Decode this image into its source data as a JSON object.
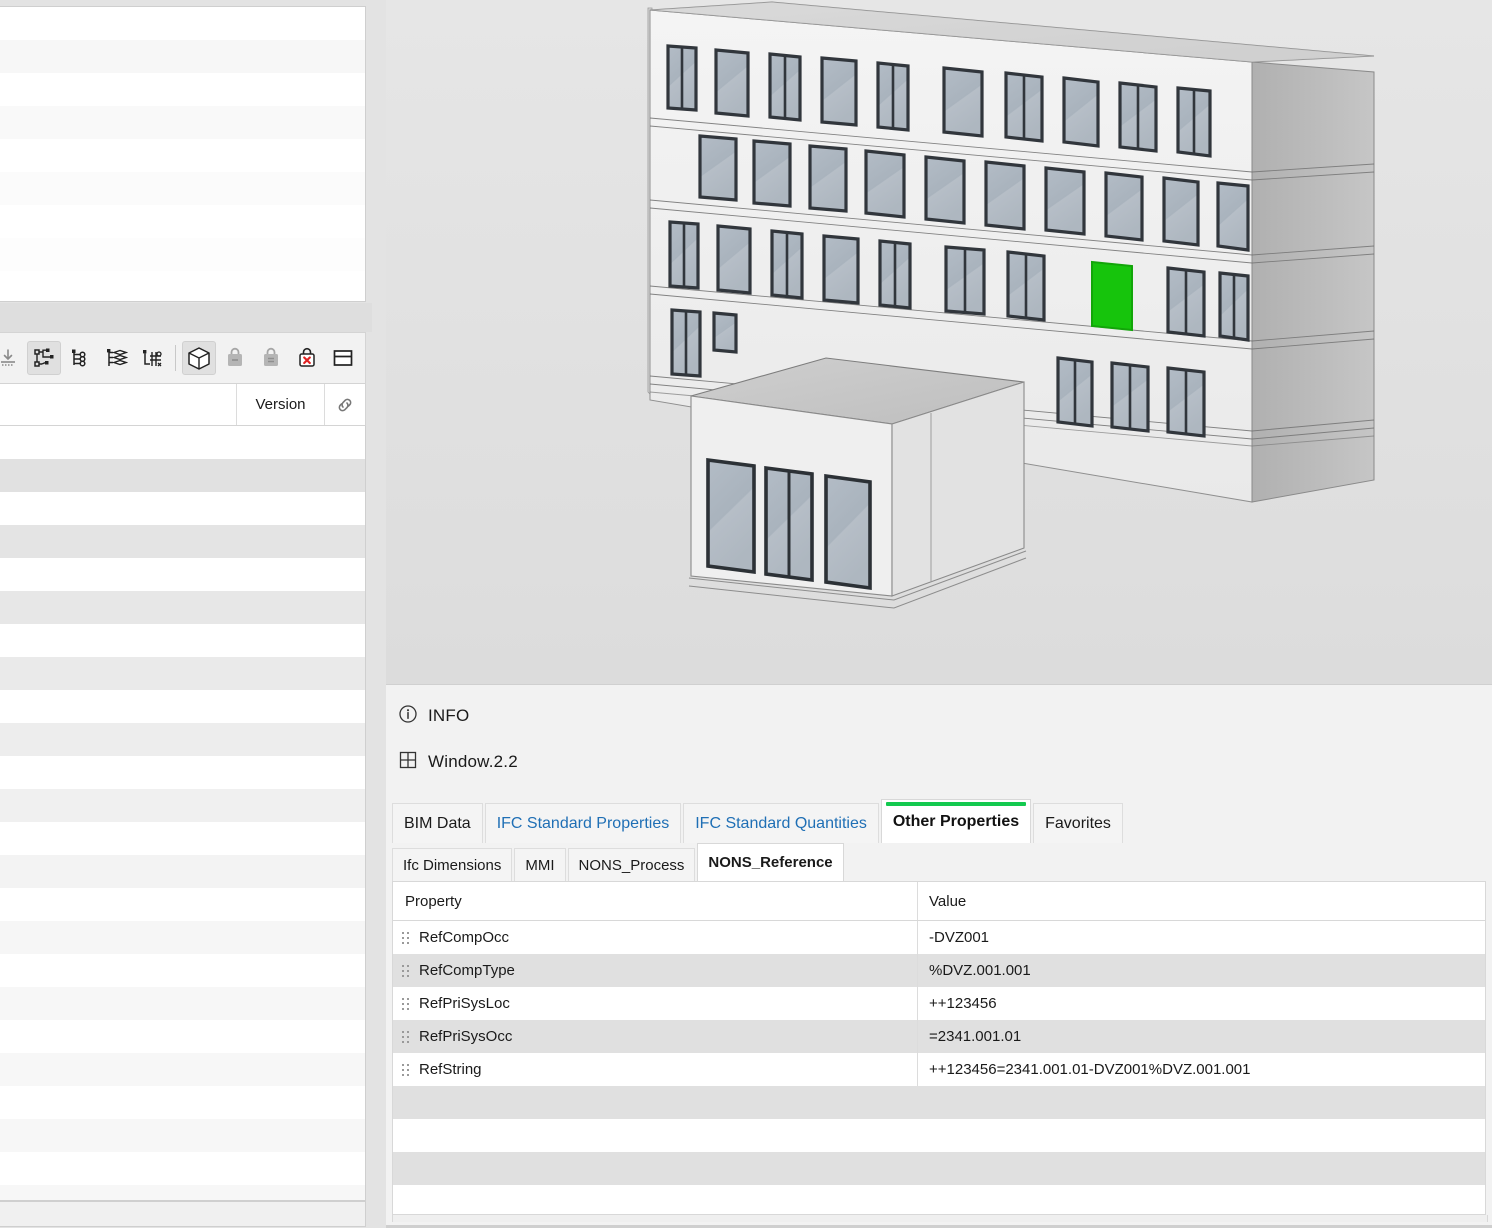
{
  "left_panel": {
    "toolbar": {
      "items": [
        {
          "name": "import-icon",
          "tooltip": "Import",
          "state": "disabled"
        },
        {
          "name": "model-tree-icon",
          "tooltip": "Model Tree",
          "state": "active"
        },
        {
          "name": "list-tree-icon",
          "tooltip": "List Tree",
          "state": "normal"
        },
        {
          "name": "layers-icon",
          "tooltip": "Layers",
          "state": "normal"
        },
        {
          "name": "structure-tree-icon",
          "tooltip": "Structure Tree",
          "state": "normal"
        },
        {
          "name": "cube-3d-icon",
          "tooltip": "3D View",
          "state": "active"
        },
        {
          "name": "bag-gray-icon",
          "tooltip": "Container",
          "state": "disabled"
        },
        {
          "name": "bag-lines-icon",
          "tooltip": "Container List",
          "state": "disabled"
        },
        {
          "name": "bag-delete-icon",
          "tooltip": "Delete Container",
          "state": "normal"
        },
        {
          "name": "panel-layout-icon",
          "tooltip": "Panel Layout",
          "state": "normal"
        }
      ]
    },
    "columns": {
      "version_label": "Version",
      "link_icon": "link-icon"
    },
    "upper_row_count": 9,
    "lower_row_count": 24
  },
  "viewport": {
    "name": "3d-model-viewport",
    "highlight_color": "#16c40c",
    "building": {
      "facade_color": "#f0f0f0",
      "side_color": "#b9b9b9",
      "roof_color": "#c9c9c9",
      "glass_color": "#aab4bf",
      "frame_color": "#3a3f45",
      "floors": 4,
      "annex_floors": 1
    }
  },
  "info": {
    "header_icon": "info-circle-icon",
    "header_label": "INFO",
    "object_icon": "window-grid-icon",
    "object_name": "Window.2.2"
  },
  "tabs": {
    "main": [
      {
        "label": "BIM Data",
        "active": false,
        "style": "dark"
      },
      {
        "label": "IFC Standard Properties",
        "active": false,
        "style": "link"
      },
      {
        "label": "IFC Standard Quantities",
        "active": false,
        "style": "link"
      },
      {
        "label": "Other Properties",
        "active": true,
        "style": "dark"
      },
      {
        "label": "Favorites",
        "active": false,
        "style": "dark"
      }
    ],
    "sub": [
      {
        "label": "Ifc Dimensions",
        "active": false
      },
      {
        "label": "MMI",
        "active": false
      },
      {
        "label": "NONS_Process",
        "active": false
      },
      {
        "label": "NONS_Reference",
        "active": true
      }
    ],
    "active_accent_color": "#13c94f"
  },
  "table": {
    "headers": {
      "property": "Property",
      "value": "Value"
    },
    "rows": [
      {
        "property": "RefCompOcc",
        "value": "-DVZ001"
      },
      {
        "property": "RefCompType",
        "value": "%DVZ.001.001"
      },
      {
        "property": "RefPriSysLoc",
        "value": "++123456"
      },
      {
        "property": "RefPriSysOcc",
        "value": "=2341.001.01"
      },
      {
        "property": "RefString",
        "value": "++123456=2341.001.01-DVZ001%DVZ.001.001"
      }
    ],
    "empty_row_count": 3
  }
}
